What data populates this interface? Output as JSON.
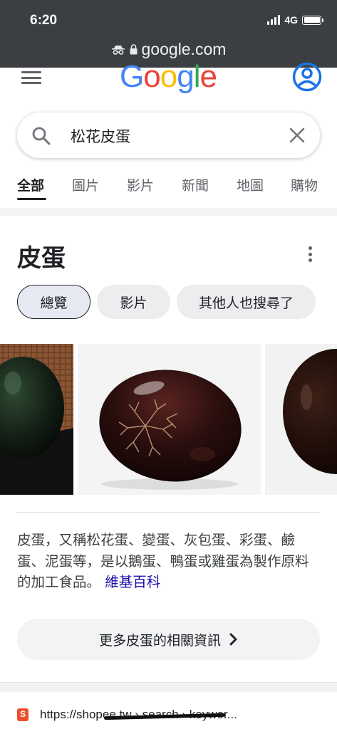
{
  "status_bar": {
    "time": "6:20",
    "network": "4G",
    "icons": [
      "signal-icon",
      "battery-icon"
    ]
  },
  "browser": {
    "url": "google.com",
    "icons": [
      "incognito-icon",
      "lock-icon"
    ]
  },
  "header": {
    "logo_letters": [
      "G",
      "o",
      "o",
      "g",
      "l",
      "e"
    ],
    "logo_colors": [
      "#4285F4",
      "#EA4335",
      "#FBBC05",
      "#4285F4",
      "#34A853",
      "#EA4335"
    ],
    "icons": [
      "hamburger-menu-icon",
      "account-circle-icon"
    ]
  },
  "search": {
    "query": "松花皮蛋",
    "icons": [
      "search-icon",
      "clear-icon"
    ]
  },
  "tabs": [
    {
      "label": "全部",
      "active": true
    },
    {
      "label": "圖片"
    },
    {
      "label": "影片"
    },
    {
      "label": "新聞"
    },
    {
      "label": "地圖"
    },
    {
      "label": "購物"
    }
  ],
  "knowledge_panel": {
    "title": "皮蛋",
    "chips": [
      {
        "label": "總覽",
        "selected": true
      },
      {
        "label": "影片"
      },
      {
        "label": "其他人也搜尋了"
      }
    ],
    "description": "皮蛋，又稱松花蛋、變蛋、灰包蛋、彩蛋、鹼蛋、泥蛋等，是以鵝蛋、鴨蛋或雞蛋為製作原料的加工食品。",
    "source_link": "維基百科",
    "more_button": "更多皮蛋的相關資訊"
  },
  "result": {
    "url": "https://shopee.tw › search › keywor..."
  },
  "colors": {
    "accent_blue": "#1a73e8",
    "link": "#1a0dab",
    "chrome_bg": "#3c3f42"
  }
}
